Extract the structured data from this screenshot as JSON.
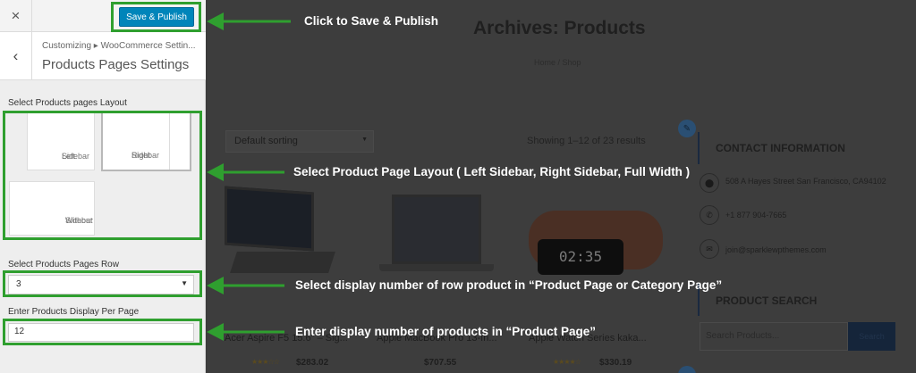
{
  "panel": {
    "close_icon": "×",
    "publish_label": "Save & Publish",
    "back_icon": "‹",
    "breadcrumb": "Customizing ▸ WooCommerce Settin...",
    "section_title": "Products Pages Settings",
    "layout_label": "Select Products pages Layout",
    "layout_options": [
      {
        "line1": "Left",
        "line2": "Sidebar"
      },
      {
        "line1": "Right",
        "line2": "Sidebar"
      },
      {
        "line1": "Without",
        "line2": "Sidebar"
      }
    ],
    "row_label": "Select Products Pages Row",
    "row_value": "3",
    "perpage_label": "Enter Products Display Per Page",
    "perpage_value": "12"
  },
  "preview": {
    "archive_title": "Archives: Products",
    "breadcrumb": "Home / Shop",
    "sorting": "Default sorting",
    "result_count": "Showing 1–12 of 23 results",
    "products": [
      {
        "name": "Acer Aspire F5 15.6\" – Sig...",
        "price": "$283.02",
        "stars": "★★★☆☆"
      },
      {
        "name": "Apple MacBook Pro 13-In...",
        "price": "$707.55",
        "stars": ""
      },
      {
        "name": "Apple Watch Series kaka...",
        "price": "$330.19",
        "stars": "★★★★☆"
      }
    ],
    "watch_time": "02:35",
    "contact_title": "CONTACT INFORMATION",
    "address": "508 A Hayes Street San Francisco, CA94102",
    "phone": "+1 877 904-7665",
    "email": "join@sparklewpthemes.com",
    "search_title": "PRODUCT SEARCH",
    "search_placeholder": "Search Products...",
    "search_button": "Search"
  },
  "annotations": {
    "publish": "Click to Save & Publish",
    "layout": "Select Product Page Layout ( Left Sidebar, Right Sidebar, Full Width )",
    "row": "Select display number of row product in “Product Page or Category Page”",
    "perpage": "Enter display number of products in “Product Page”"
  },
  "colors": {
    "annotation_green": "#2f9f2f",
    "publish_blue": "#0085ba"
  }
}
